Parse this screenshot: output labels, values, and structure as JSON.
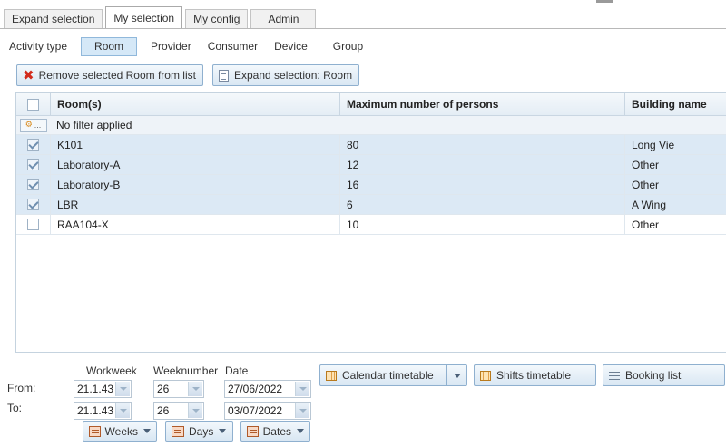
{
  "tabs": [
    {
      "label": "Expand selection"
    },
    {
      "label": "My selection"
    },
    {
      "label": "My config"
    },
    {
      "label": "Admin"
    }
  ],
  "subtabs": [
    {
      "label": "Activity type"
    },
    {
      "label": "Room"
    },
    {
      "label": "Provider"
    },
    {
      "label": "Consumer"
    },
    {
      "label": "Device"
    },
    {
      "label": "Group"
    }
  ],
  "actions": {
    "remove_label": "Remove selected Room from list",
    "expand_label": "Expand selection: Room"
  },
  "grid": {
    "columns": [
      "Room(s)",
      "Maximum number of persons",
      "Building name"
    ],
    "filter_button": "...",
    "filter_text": "No filter applied",
    "rows": [
      {
        "room": "K101",
        "max": "80",
        "building": "Long Vie",
        "checked": true
      },
      {
        "room": "Laboratory-A",
        "max": "12",
        "building": "Other",
        "checked": true
      },
      {
        "room": "Laboratory-B",
        "max": "16",
        "building": "Other",
        "checked": true
      },
      {
        "room": "LBR",
        "max": "6",
        "building": "A Wing",
        "checked": true
      },
      {
        "room": "RAA104-X",
        "max": "10",
        "building": "Other",
        "checked": false
      }
    ]
  },
  "period": {
    "headers": {
      "workweek": "Workweek",
      "weeknumber": "Weeknumber",
      "date": "Date"
    },
    "from_label": "From:",
    "to_label": "To:",
    "from": {
      "workweek": "21.1.43",
      "weeknumber": "26",
      "date": "27/06/2022"
    },
    "to": {
      "workweek": "21.1.43",
      "weeknumber": "26",
      "date": "03/07/2022"
    },
    "unit_buttons": [
      "Weeks",
      "Days",
      "Dates"
    ]
  },
  "views": {
    "calendar": "Calendar timetable",
    "shifts": "Shifts timetable",
    "booking": "Booking list"
  },
  "colors": {
    "selected_row": "#dce9f5",
    "active_subtab": "#d5e8f7",
    "remove_icon": "#d22b1c"
  }
}
